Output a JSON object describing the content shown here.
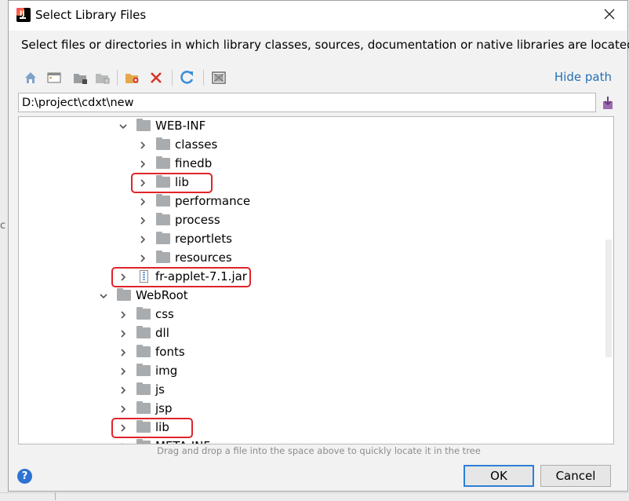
{
  "window": {
    "title": "Select Library Files",
    "close_icon": "close-icon"
  },
  "description": "Select files or directories in which library classes, sources, documentation or native libraries are located",
  "toolbar": {
    "icons": [
      "home-icon",
      "desktop-icon",
      "project-icon",
      "module-icon",
      "new-folder-icon",
      "delete-icon",
      "refresh-icon",
      "show-hidden-icon"
    ],
    "hide_path_label": "Hide path",
    "colors": {
      "accent": "#2470b3",
      "delete": "#d9342b",
      "refresh": "#3a8fd8"
    }
  },
  "path": {
    "value": "D:\\project\\cdxt\\new",
    "browse_icon": "history-icon"
  },
  "tree": {
    "items": [
      {
        "label": "WEB-INF",
        "type": "folder",
        "expanded": true
      },
      {
        "label": "classes",
        "type": "folder",
        "expanded": false
      },
      {
        "label": "finedb",
        "type": "folder",
        "expanded": false
      },
      {
        "label": "lib",
        "type": "folder",
        "expanded": false,
        "highlighted": true
      },
      {
        "label": "performance",
        "type": "folder",
        "expanded": false
      },
      {
        "label": "process",
        "type": "folder",
        "expanded": false
      },
      {
        "label": "reportlets",
        "type": "folder",
        "expanded": false
      },
      {
        "label": "resources",
        "type": "folder",
        "expanded": false
      },
      {
        "label": "fr-applet-7.1.jar",
        "type": "jar",
        "expanded": false,
        "highlighted": true
      },
      {
        "label": "WebRoot",
        "type": "folder",
        "expanded": true
      },
      {
        "label": "css",
        "type": "folder",
        "expanded": false
      },
      {
        "label": "dll",
        "type": "folder",
        "expanded": false
      },
      {
        "label": "fonts",
        "type": "folder",
        "expanded": false
      },
      {
        "label": "img",
        "type": "folder",
        "expanded": false
      },
      {
        "label": "js",
        "type": "folder",
        "expanded": false
      },
      {
        "label": "jsp",
        "type": "folder",
        "expanded": false
      },
      {
        "label": "lib",
        "type": "folder",
        "expanded": false,
        "highlighted": true
      },
      {
        "label": "META-INF",
        "type": "folder",
        "expanded": false
      }
    ],
    "highlight_color": "#e0242a"
  },
  "hint": "Drag and drop a file into the space above to quickly locate it in the tree",
  "footer": {
    "help_label": "?",
    "ok_label": "OK",
    "cancel_label": "Cancel",
    "ok_border_color": "#2e7fd6"
  },
  "background": {
    "fragment": "c"
  }
}
